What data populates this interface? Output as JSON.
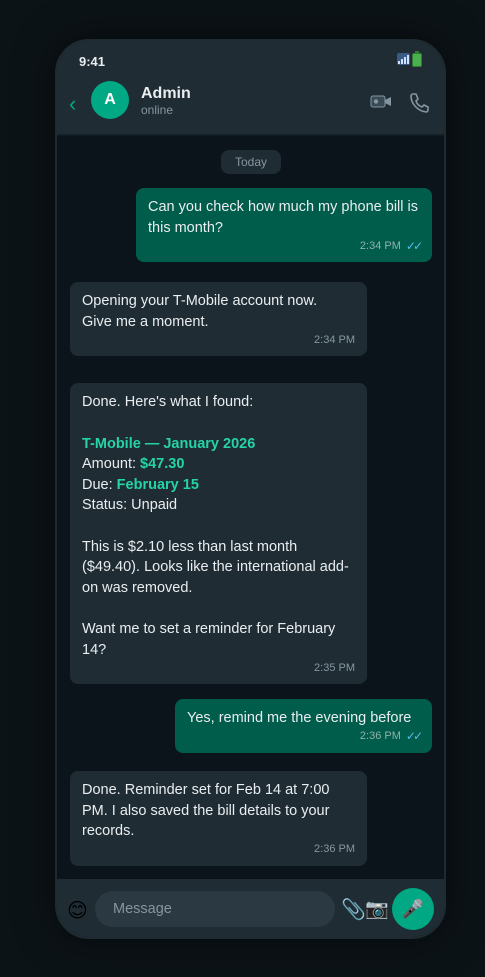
{
  "status_bar": {
    "time": "9:41"
  },
  "header": {
    "back_label": "‹",
    "avatar_initial": "A",
    "name": "Admin",
    "status": "online"
  },
  "chat": {
    "day_label": "Today",
    "messages": [
      {
        "direction": "out",
        "text": "Can you check how much my phone bill is this month?",
        "time": "2:34 PM",
        "ticks": "✓✓"
      },
      {
        "direction": "in",
        "text_lines": [
          "Opening your T-Mobile account now.",
          "Give me a moment."
        ],
        "time": "2:34 PM"
      },
      {
        "direction": "in",
        "intro": "Done. Here's what I found:",
        "bill_title": "T-Mobile — January 2026",
        "amount_label": "Amount: ",
        "amount_value": "$47.30",
        "due_label": "Due: ",
        "due_value": "February 15",
        "status_line": "Status: Unpaid",
        "comparison": "This is $2.10 less than last month ($49.40). Looks like the international add-on was removed.",
        "question": "Want me to set a reminder for February 14?",
        "time": "2:35 PM"
      },
      {
        "direction": "out",
        "text": "Yes, remind me the evening before",
        "time": "2:36 PM",
        "ticks": "✓✓"
      },
      {
        "direction": "in",
        "text": "Done. Reminder set for Feb 14 at 7:00 PM. I also saved the bill details to your records.",
        "time": "2:36 PM"
      }
    ]
  },
  "composer": {
    "placeholder": "Message",
    "emoji_glyph": "😊",
    "attach_glyph": "📎",
    "camera_glyph": "📷",
    "mic_glyph": "🎤"
  },
  "colors": {
    "accent": "#00a884",
    "outgoing_bubble": "#005c4b",
    "incoming_bubble": "#1f2c34",
    "highlight": "#25d3a7",
    "read_ticks": "#53bdeb"
  },
  "icons": {
    "status": [
      "signal-icon",
      "battery-icon"
    ],
    "header": [
      "back-chevron-icon",
      "video-camera-icon",
      "phone-icon"
    ],
    "composer": [
      "emoji-icon",
      "paperclip-icon",
      "camera-icon",
      "microphone-icon"
    ]
  }
}
